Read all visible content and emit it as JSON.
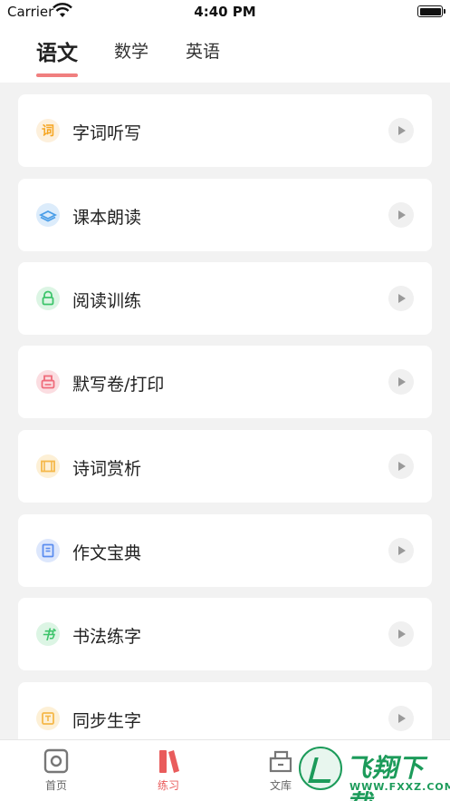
{
  "status_bar": {
    "carrier": "Carrier",
    "time": "4:40 PM"
  },
  "tabs": [
    {
      "label": "语文",
      "active": true
    },
    {
      "label": "数学",
      "active": false
    },
    {
      "label": "英语",
      "active": false
    }
  ],
  "items": [
    {
      "label": "字词听写",
      "icon": "ci-char-icon",
      "color": "#f5a623"
    },
    {
      "label": "课本朗读",
      "icon": "book-layers-icon",
      "color": "#4a9ee8"
    },
    {
      "label": "阅读训练",
      "icon": "lock-icon",
      "color": "#3cc46a"
    },
    {
      "label": "默写卷/打印",
      "icon": "printer-icon",
      "color": "#ef6b7a"
    },
    {
      "label": "诗词赏析",
      "icon": "scroll-icon",
      "color": "#f5b84a"
    },
    {
      "label": "作文宝典",
      "icon": "notebook-icon",
      "color": "#5b8def"
    },
    {
      "label": "书法练字",
      "icon": "calligraphy-icon",
      "color": "#3cc46a"
    },
    {
      "label": "同步生字",
      "icon": "text-box-icon",
      "color": "#f5b84a"
    }
  ],
  "bottom_nav": [
    {
      "label": "首页",
      "icon": "home-icon",
      "active": false
    },
    {
      "label": "练习",
      "icon": "practice-icon",
      "active": true
    },
    {
      "label": "文库",
      "icon": "library-icon",
      "active": false
    }
  ],
  "watermark": {
    "text": "飞翔下载",
    "url": "WWW.FXXZ.COM"
  }
}
